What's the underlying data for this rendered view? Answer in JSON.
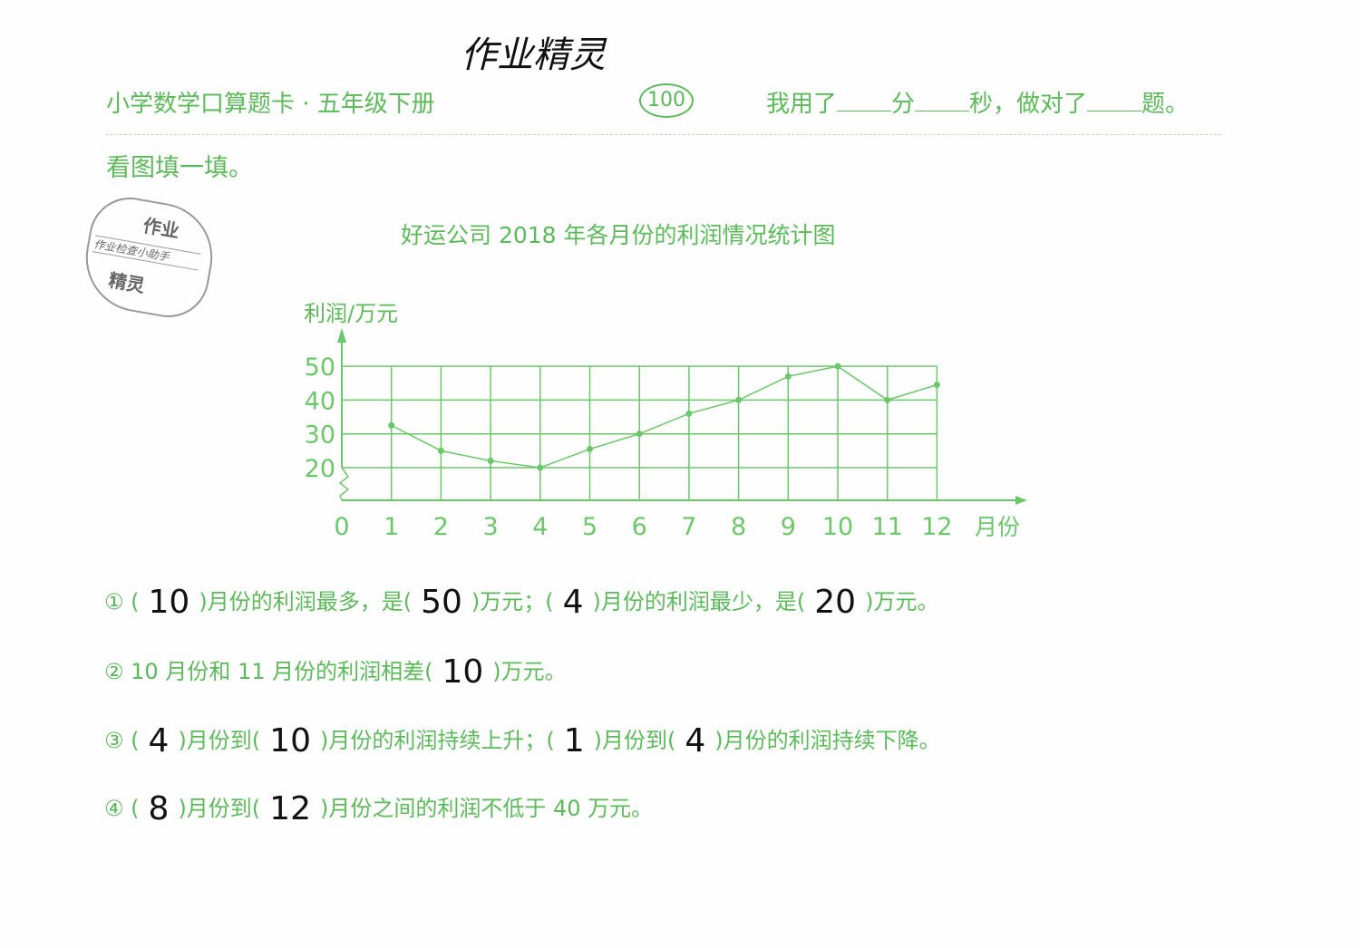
{
  "header": {
    "handwritten_title": "作业精灵",
    "book_title": "小学数学口算题卡 · 五年级下册",
    "page_number": "100",
    "timer": {
      "prefix": "我用了",
      "min": "分",
      "sec": "秒，做对了",
      "end": "题。"
    }
  },
  "instruction": "看图填一填。",
  "stamp": {
    "top": "作业",
    "middle": "作业检查小助手",
    "bottom": "精灵"
  },
  "chart_data": {
    "type": "line",
    "title": "好运公司 2018 年各月份的利润情况统计图",
    "ylabel": "利润/万元",
    "xlabel": "月份",
    "x": [
      1,
      2,
      3,
      4,
      5,
      6,
      7,
      8,
      9,
      10,
      11,
      12
    ],
    "values": [
      32.5,
      25,
      22,
      20,
      25.5,
      30,
      36,
      40,
      47,
      50,
      40,
      44.5
    ],
    "yticks": [
      20,
      30,
      40,
      50
    ],
    "xticks": [
      0,
      1,
      2,
      3,
      4,
      5,
      6,
      7,
      8,
      9,
      10,
      11,
      12
    ],
    "ylim": [
      20,
      50
    ],
    "y_axis_break": true,
    "grid": true,
    "color": "#6cc76a"
  },
  "questions": [
    {
      "num": "①",
      "parts": [
        "(",
        "10",
        ")月份的利润最多，是(",
        "50",
        ")万元；(",
        "4",
        ")月份的利润最少，是(",
        "20",
        ")万元。"
      ]
    },
    {
      "num": "②",
      "parts": [
        "10 月份和 11 月份的利润相差(",
        "10",
        ")万元。"
      ]
    },
    {
      "num": "③",
      "parts": [
        "(",
        "4",
        ")月份到(",
        "10",
        ")月份的利润持续上升；(",
        "1",
        ")月份到(",
        "4",
        ")月份的利润持续下降。"
      ]
    },
    {
      "num": "④",
      "parts": [
        "(",
        "8",
        ")月份到(",
        "12",
        ")月份之间的利润不低于 40 万元。"
      ]
    }
  ]
}
